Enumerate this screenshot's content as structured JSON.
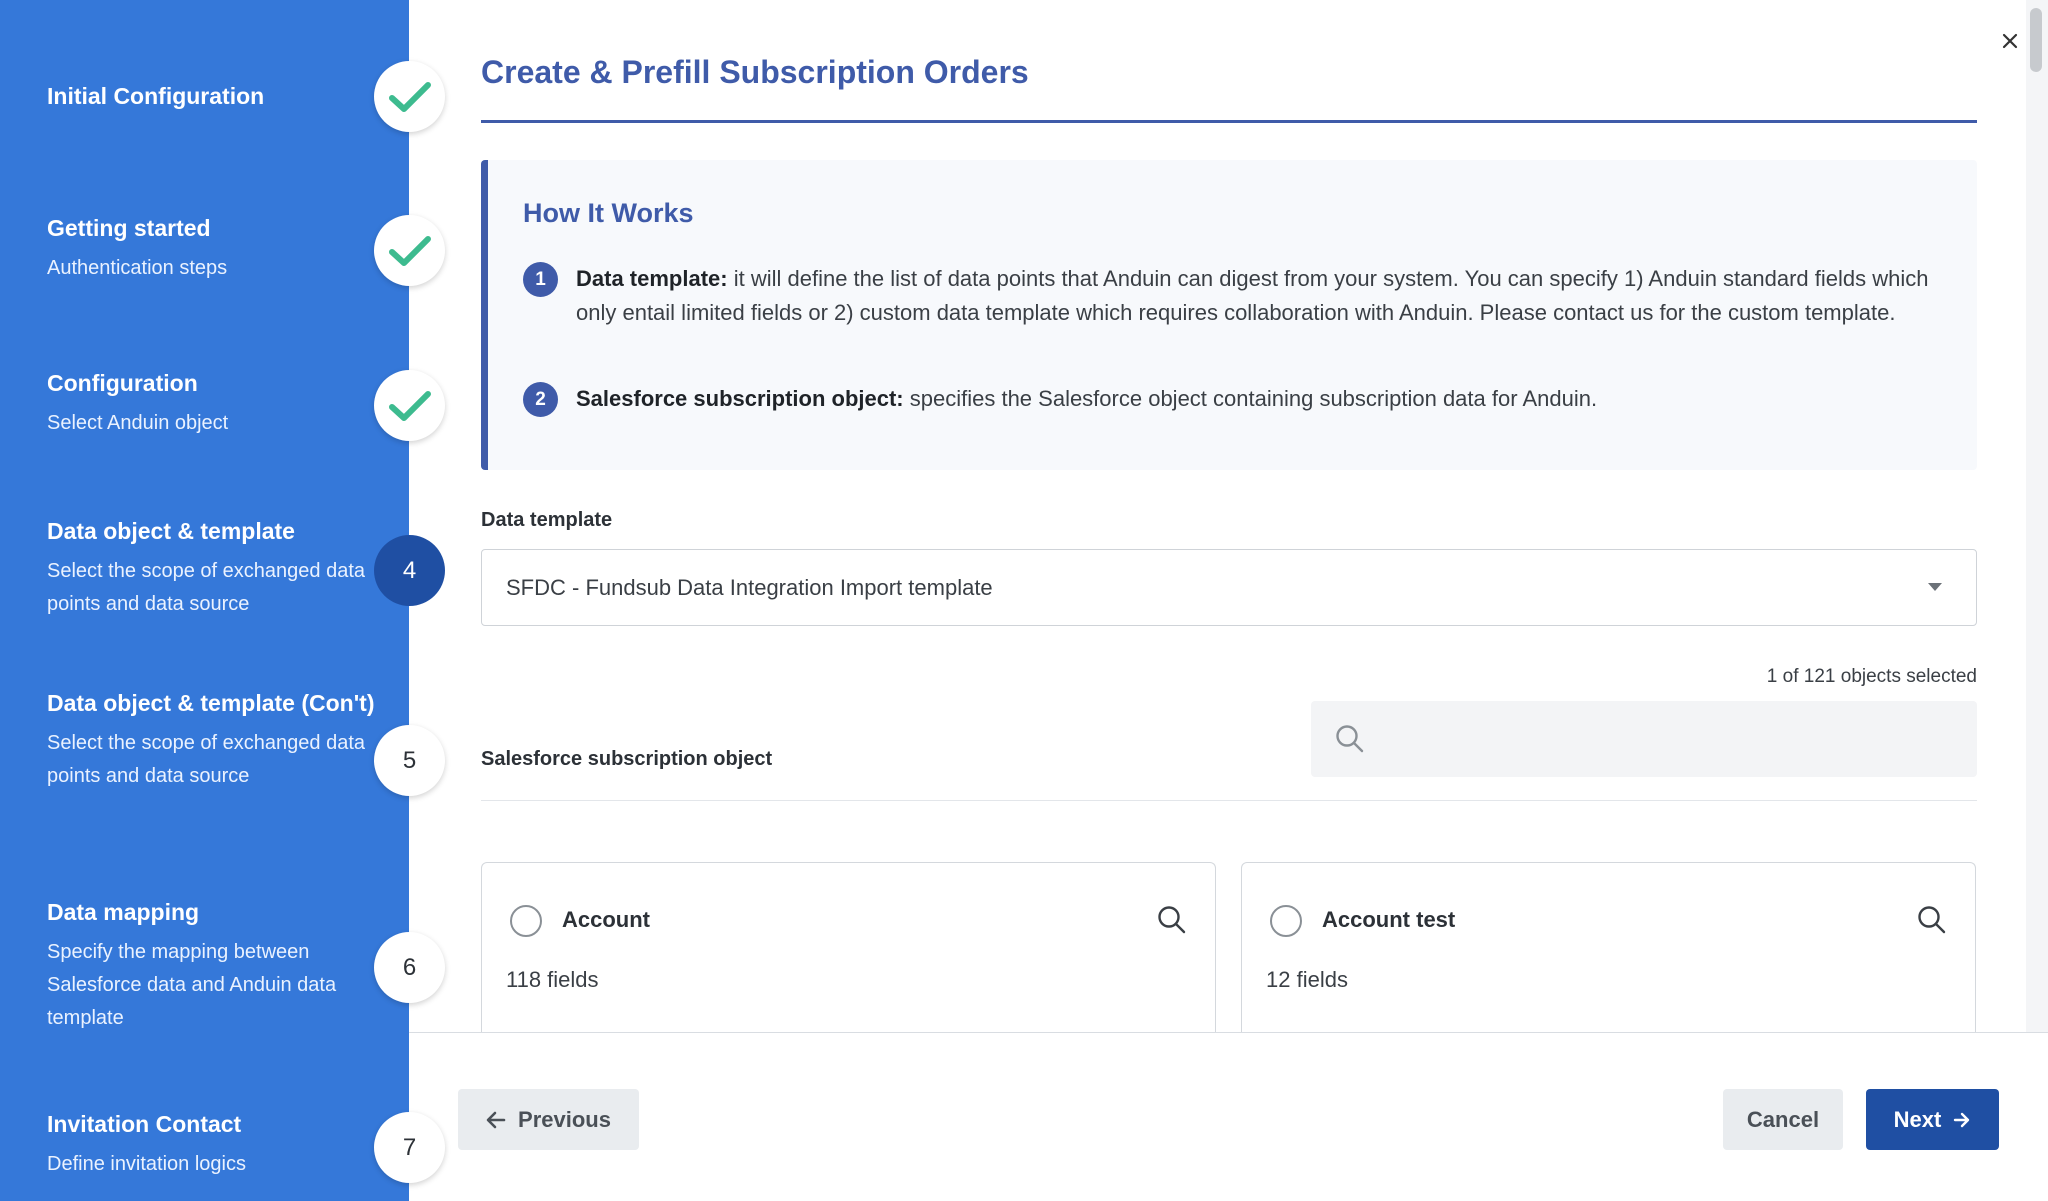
{
  "sidebar": {
    "steps": [
      {
        "title": "Initial Configuration",
        "subtitle": "",
        "marker": "check"
      },
      {
        "title": "Getting started",
        "subtitle": "Authentication steps",
        "marker": "check"
      },
      {
        "title": "Configuration",
        "subtitle": "Select Anduin object",
        "marker": "check"
      },
      {
        "title": "Data object & template",
        "subtitle": "Select the scope of exchanged data points and data source",
        "marker": "4"
      },
      {
        "title": "Data object & template (Con't)",
        "subtitle": "Select the scope of exchanged data points and data source",
        "marker": "5"
      },
      {
        "title": "Data mapping",
        "subtitle": "Specify the mapping between Salesforce data and Anduin data template",
        "marker": "6"
      },
      {
        "title": "Invitation Contact",
        "subtitle": "Define invitation logics",
        "marker": "7"
      }
    ]
  },
  "header": {
    "title": "Create & Prefill Subscription Orders"
  },
  "how_it_works": {
    "title": "How It Works",
    "items": [
      {
        "num": "1",
        "term": "Data template:",
        "text": " it will define the list of data points that Anduin can digest from your system. You can specify 1) Anduin standard fields which only entail limited fields or 2) custom data template which requires collaboration with Anduin. Please contact us for the custom template."
      },
      {
        "num": "2",
        "term": "Salesforce subscription object:",
        "text": " specifies the Salesforce object containing subscription data for Anduin."
      }
    ]
  },
  "data_template": {
    "label": "Data template",
    "selected": "SFDC - Fundsub Data Integration Import template"
  },
  "subscription_object": {
    "label": "Salesforce subscription object",
    "counter": "1 of 121 objects selected",
    "objects": [
      {
        "name": "Account",
        "fields": "118 fields"
      },
      {
        "name": "Account test",
        "fields": "12 fields"
      }
    ]
  },
  "footer": {
    "previous": "Previous",
    "cancel": "Cancel",
    "next": "Next"
  },
  "icons": {
    "close": "close-icon",
    "search": "search-icon",
    "check": "check-icon",
    "arrow_left": "arrow-left-icon",
    "arrow_right": "arrow-right-icon",
    "caret": "caret-down-icon"
  },
  "colors": {
    "sidebar": "#3578d9",
    "accent": "#3f5ba9",
    "primary_button": "#1f4fa3",
    "check": "#3dbb8f"
  }
}
